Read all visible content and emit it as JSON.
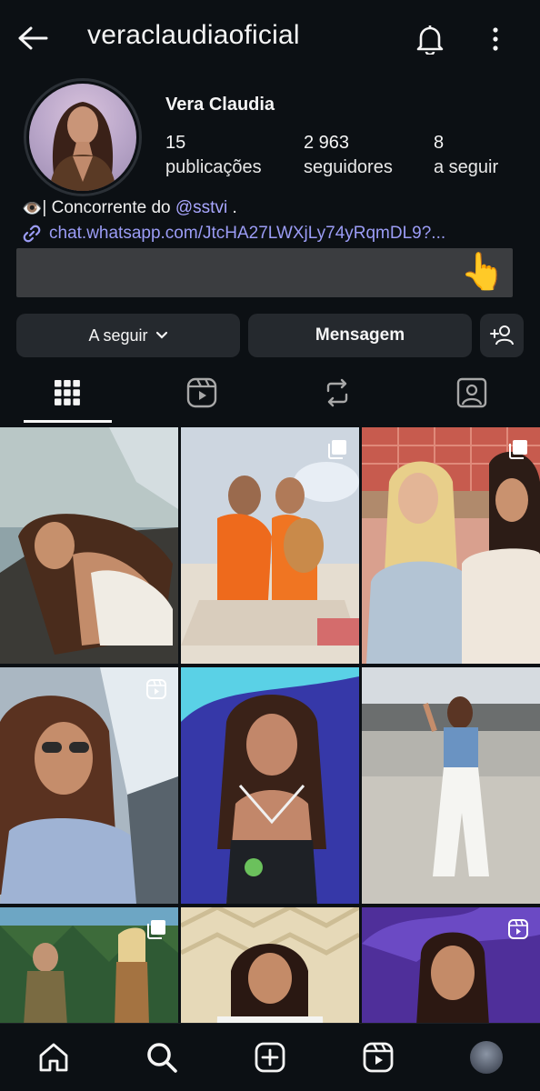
{
  "header": {
    "username": "veraclaudiaoficial",
    "back_icon": "arrow-left-icon",
    "notification_icon": "bell-icon",
    "more_icon": "more-vertical-icon"
  },
  "profile": {
    "full_name": "Vera Claudia",
    "stats": [
      {
        "value": "15",
        "label": "publicações"
      },
      {
        "value": "2 963",
        "label": "seguidores"
      },
      {
        "value": "8",
        "label": "a seguir"
      }
    ],
    "bio_emoji": "👁️",
    "bio_text": "| Concorrente do ",
    "bio_mention": "@sstvi",
    "bio_end": " .",
    "link": "chat.whatsapp.com/JtcHA27LWXjLy74yRqmDL9?...",
    "banner_emoji": "👆"
  },
  "actions": {
    "follow_label": "A seguir",
    "message_label": "Mensagem"
  },
  "tabs": [
    "grid-icon",
    "reels-icon",
    "reposts-icon",
    "tagged-icon"
  ],
  "posts": [
    {
      "type": "photo"
    },
    {
      "type": "carousel"
    },
    {
      "type": "carousel"
    },
    {
      "type": "reel"
    },
    {
      "type": "photo"
    },
    {
      "type": "photo"
    },
    {
      "type": "carousel"
    },
    {
      "type": "photo"
    },
    {
      "type": "reel"
    }
  ],
  "colors": {
    "background": "#0c1014",
    "button": "#25292e",
    "link": "#9b9cf5",
    "mention": "#a9a7ff"
  },
  "bottom_nav": [
    "home-icon",
    "search-icon",
    "create-icon",
    "reels-icon",
    "profile-avatar"
  ]
}
